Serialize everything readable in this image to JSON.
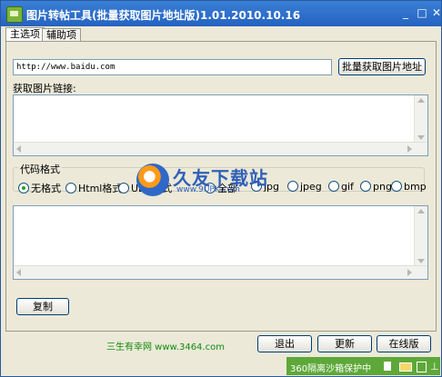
{
  "window": {
    "title": "图片转帖工具(批量获取图片地址版)1.01.2010.10.16"
  },
  "title_buttons": {
    "minimize": "_",
    "maximize": "□",
    "close": "✕"
  },
  "tabs": [
    {
      "label": "主选项"
    },
    {
      "label": "辅助项"
    }
  ],
  "url_field": {
    "value": "http://www.baidu.com"
  },
  "buttons": {
    "batch_get": "批量获取图片地址",
    "copy": "复制",
    "exit": "退出",
    "update": "更新",
    "online": "在线版"
  },
  "labels": {
    "image_links": "获取图片链接:",
    "code_format": "代码格式"
  },
  "format_options": [
    {
      "label": "无格式",
      "checked": true
    },
    {
      "label": "Html格式",
      "checked": false
    },
    {
      "label": "UBB格式",
      "checked": false
    }
  ],
  "type_options": [
    {
      "label": "全部",
      "checked": false
    },
    {
      "label": "jpg",
      "checked": false
    },
    {
      "label": "jpeg",
      "checked": false
    },
    {
      "label": "gif",
      "checked": false
    },
    {
      "label": "png",
      "checked": false
    },
    {
      "label": "bmp",
      "checked": false
    }
  ],
  "footer": {
    "link_text": "三生有幸网 www.3464.com"
  },
  "status": {
    "text": "360隔离沙箱保护中"
  },
  "watermark": {
    "brand": "久友下载站",
    "url": "www.9UPK.com"
  },
  "colors": {
    "titlebar": "#2563c0",
    "status_green": "#5ea83a",
    "footer_green": "#0f8a0f"
  }
}
